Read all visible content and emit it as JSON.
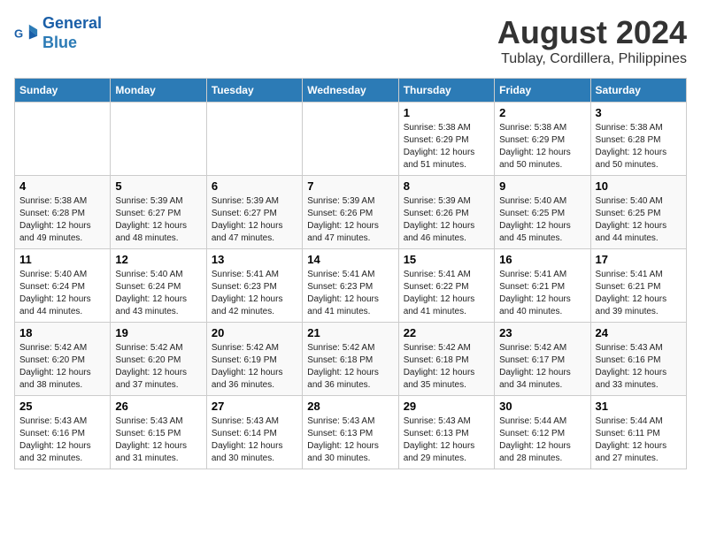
{
  "logo": {
    "line1": "General",
    "line2": "Blue"
  },
  "title": "August 2024",
  "subtitle": "Tublay, Cordillera, Philippines",
  "days_of_week": [
    "Sunday",
    "Monday",
    "Tuesday",
    "Wednesday",
    "Thursday",
    "Friday",
    "Saturday"
  ],
  "weeks": [
    [
      {
        "day": "",
        "info": ""
      },
      {
        "day": "",
        "info": ""
      },
      {
        "day": "",
        "info": ""
      },
      {
        "day": "",
        "info": ""
      },
      {
        "day": "1",
        "info": "Sunrise: 5:38 AM\nSunset: 6:29 PM\nDaylight: 12 hours and 51 minutes."
      },
      {
        "day": "2",
        "info": "Sunrise: 5:38 AM\nSunset: 6:29 PM\nDaylight: 12 hours and 50 minutes."
      },
      {
        "day": "3",
        "info": "Sunrise: 5:38 AM\nSunset: 6:28 PM\nDaylight: 12 hours and 50 minutes."
      }
    ],
    [
      {
        "day": "4",
        "info": "Sunrise: 5:38 AM\nSunset: 6:28 PM\nDaylight: 12 hours and 49 minutes."
      },
      {
        "day": "5",
        "info": "Sunrise: 5:39 AM\nSunset: 6:27 PM\nDaylight: 12 hours and 48 minutes."
      },
      {
        "day": "6",
        "info": "Sunrise: 5:39 AM\nSunset: 6:27 PM\nDaylight: 12 hours and 47 minutes."
      },
      {
        "day": "7",
        "info": "Sunrise: 5:39 AM\nSunset: 6:26 PM\nDaylight: 12 hours and 47 minutes."
      },
      {
        "day": "8",
        "info": "Sunrise: 5:39 AM\nSunset: 6:26 PM\nDaylight: 12 hours and 46 minutes."
      },
      {
        "day": "9",
        "info": "Sunrise: 5:40 AM\nSunset: 6:25 PM\nDaylight: 12 hours and 45 minutes."
      },
      {
        "day": "10",
        "info": "Sunrise: 5:40 AM\nSunset: 6:25 PM\nDaylight: 12 hours and 44 minutes."
      }
    ],
    [
      {
        "day": "11",
        "info": "Sunrise: 5:40 AM\nSunset: 6:24 PM\nDaylight: 12 hours and 44 minutes."
      },
      {
        "day": "12",
        "info": "Sunrise: 5:40 AM\nSunset: 6:24 PM\nDaylight: 12 hours and 43 minutes."
      },
      {
        "day": "13",
        "info": "Sunrise: 5:41 AM\nSunset: 6:23 PM\nDaylight: 12 hours and 42 minutes."
      },
      {
        "day": "14",
        "info": "Sunrise: 5:41 AM\nSunset: 6:23 PM\nDaylight: 12 hours and 41 minutes."
      },
      {
        "day": "15",
        "info": "Sunrise: 5:41 AM\nSunset: 6:22 PM\nDaylight: 12 hours and 41 minutes."
      },
      {
        "day": "16",
        "info": "Sunrise: 5:41 AM\nSunset: 6:21 PM\nDaylight: 12 hours and 40 minutes."
      },
      {
        "day": "17",
        "info": "Sunrise: 5:41 AM\nSunset: 6:21 PM\nDaylight: 12 hours and 39 minutes."
      }
    ],
    [
      {
        "day": "18",
        "info": "Sunrise: 5:42 AM\nSunset: 6:20 PM\nDaylight: 12 hours and 38 minutes."
      },
      {
        "day": "19",
        "info": "Sunrise: 5:42 AM\nSunset: 6:20 PM\nDaylight: 12 hours and 37 minutes."
      },
      {
        "day": "20",
        "info": "Sunrise: 5:42 AM\nSunset: 6:19 PM\nDaylight: 12 hours and 36 minutes."
      },
      {
        "day": "21",
        "info": "Sunrise: 5:42 AM\nSunset: 6:18 PM\nDaylight: 12 hours and 36 minutes."
      },
      {
        "day": "22",
        "info": "Sunrise: 5:42 AM\nSunset: 6:18 PM\nDaylight: 12 hours and 35 minutes."
      },
      {
        "day": "23",
        "info": "Sunrise: 5:42 AM\nSunset: 6:17 PM\nDaylight: 12 hours and 34 minutes."
      },
      {
        "day": "24",
        "info": "Sunrise: 5:43 AM\nSunset: 6:16 PM\nDaylight: 12 hours and 33 minutes."
      }
    ],
    [
      {
        "day": "25",
        "info": "Sunrise: 5:43 AM\nSunset: 6:16 PM\nDaylight: 12 hours and 32 minutes."
      },
      {
        "day": "26",
        "info": "Sunrise: 5:43 AM\nSunset: 6:15 PM\nDaylight: 12 hours and 31 minutes."
      },
      {
        "day": "27",
        "info": "Sunrise: 5:43 AM\nSunset: 6:14 PM\nDaylight: 12 hours and 30 minutes."
      },
      {
        "day": "28",
        "info": "Sunrise: 5:43 AM\nSunset: 6:13 PM\nDaylight: 12 hours and 30 minutes."
      },
      {
        "day": "29",
        "info": "Sunrise: 5:43 AM\nSunset: 6:13 PM\nDaylight: 12 hours and 29 minutes."
      },
      {
        "day": "30",
        "info": "Sunrise: 5:44 AM\nSunset: 6:12 PM\nDaylight: 12 hours and 28 minutes."
      },
      {
        "day": "31",
        "info": "Sunrise: 5:44 AM\nSunset: 6:11 PM\nDaylight: 12 hours and 27 minutes."
      }
    ]
  ]
}
